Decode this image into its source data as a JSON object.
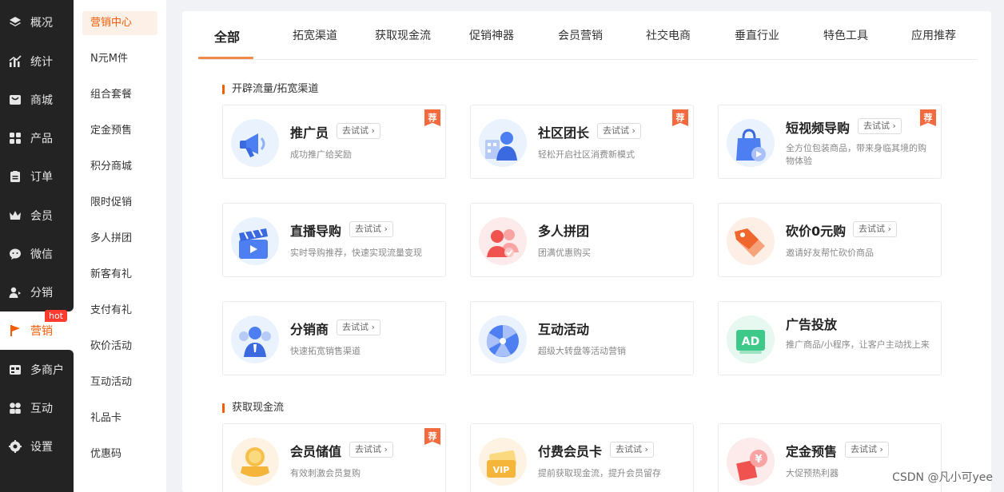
{
  "nav": {
    "items": [
      {
        "label": "概况",
        "icon": "layers-icon"
      },
      {
        "label": "统计",
        "icon": "chart-icon"
      },
      {
        "label": "商城",
        "icon": "store-icon"
      },
      {
        "label": "产品",
        "icon": "grid-icon"
      },
      {
        "label": "订单",
        "icon": "order-icon"
      },
      {
        "label": "会员",
        "icon": "crown-icon"
      },
      {
        "label": "微信",
        "icon": "wechat-icon"
      },
      {
        "label": "分销",
        "icon": "user-share-icon"
      },
      {
        "label": "营销",
        "icon": "flag-icon"
      },
      {
        "label": "多商户",
        "icon": "multi-store-icon"
      },
      {
        "label": "互动",
        "icon": "interact-icon"
      },
      {
        "label": "设置",
        "icon": "gear-icon"
      }
    ],
    "hot_badge": "hot"
  },
  "subnav": {
    "items": [
      "营销中心",
      "N元M件",
      "组合套餐",
      "定金预售",
      "积分商城",
      "限时促销",
      "多人拼团",
      "新客有礼",
      "支付有礼",
      "砍价活动",
      "互动活动",
      "礼品卡",
      "优惠码"
    ]
  },
  "tabs": [
    "全部",
    "拓宽渠道",
    "获取现金流",
    "促销神器",
    "会员营销",
    "社交电商",
    "垂直行业",
    "特色工具",
    "应用推荐"
  ],
  "sections": {
    "s1": "开辟流量/拓宽渠道",
    "s2": "获取现金流"
  },
  "try_label": "去试试",
  "rec_label": "荐",
  "cards": [
    {
      "title": "推广员",
      "desc": "成功推广给奖励",
      "recommended": true,
      "icon": "megaphone-icon"
    },
    {
      "title": "社区团长",
      "desc": "轻松开启社区消费新模式",
      "recommended": true,
      "icon": "community-leader-icon"
    },
    {
      "title": "短视频导购",
      "desc": "全方位包装商品，带来身临其境的购物体验",
      "recommended": true,
      "icon": "video-shopping-icon"
    },
    {
      "title": "直播导购",
      "desc": "实时导购推荐，快速实现流量变现",
      "recommended": false,
      "icon": "clapperboard-icon"
    },
    {
      "title": "多人拼团",
      "desc": "团满优惠购买",
      "recommended": false,
      "icon": "group-buy-icon"
    },
    {
      "title": "砍价0元购",
      "desc": "邀请好友帮忙砍价商品",
      "recommended": false,
      "icon": "price-tag-icon"
    },
    {
      "title": "分销商",
      "desc": "快速拓宽销售渠道",
      "recommended": false,
      "icon": "distributor-icon"
    },
    {
      "title": "互动活动",
      "desc": "超级大转盘等活动营销",
      "recommended": false,
      "icon": "wheel-icon"
    },
    {
      "title": "广告投放",
      "desc": "推广商品/小程序，让客户主动找上来",
      "recommended": false,
      "icon": "ad-icon"
    },
    {
      "title": "会员储值",
      "desc": "有效刺激会员复购",
      "recommended": true,
      "icon": "coin-icon"
    },
    {
      "title": "付费会员卡",
      "desc": "提前获取现金流，提升会员留存",
      "recommended": false,
      "icon": "vip-card-icon"
    },
    {
      "title": "定金预售",
      "desc": "大促预热利器",
      "recommended": false,
      "icon": "deposit-icon"
    }
  ],
  "watermark": "CSDN @凡小可yee",
  "colors": {
    "accent": "#f25c05",
    "nav_bg": "#232323",
    "rec_badge": "#f26a3d"
  }
}
